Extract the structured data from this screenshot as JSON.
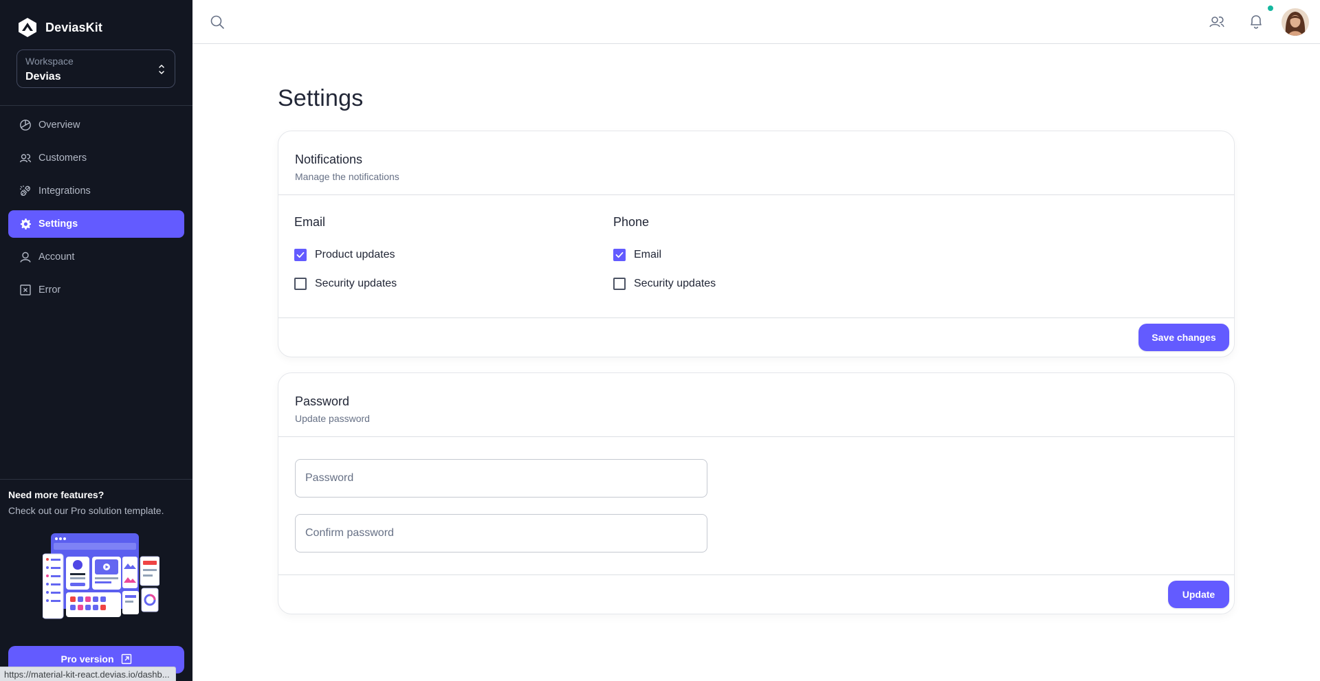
{
  "brand": {
    "name": "DeviasKit"
  },
  "workspace": {
    "label": "Workspace",
    "value": "Devias"
  },
  "nav": [
    {
      "label": "Overview",
      "icon": "chart-pie-icon"
    },
    {
      "label": "Customers",
      "icon": "users-icon"
    },
    {
      "label": "Integrations",
      "icon": "plugs-icon"
    },
    {
      "label": "Settings",
      "icon": "gear-icon",
      "active": true
    },
    {
      "label": "Account",
      "icon": "user-icon"
    },
    {
      "label": "Error",
      "icon": "x-square-icon"
    }
  ],
  "promo": {
    "title": "Need more features?",
    "subtitle": "Check out our Pro solution template.",
    "button": "Pro version"
  },
  "status_url": "https://material-kit-react.devias.io/dashb...",
  "page": {
    "title": "Settings"
  },
  "notifications": {
    "title": "Notifications",
    "subtitle": "Manage the notifications",
    "email": {
      "title": "Email",
      "options": [
        {
          "label": "Product updates",
          "checked": true
        },
        {
          "label": "Security updates",
          "checked": false
        }
      ]
    },
    "phone": {
      "title": "Phone",
      "options": [
        {
          "label": "Email",
          "checked": true
        },
        {
          "label": "Security updates",
          "checked": false
        }
      ]
    },
    "save_label": "Save changes"
  },
  "password": {
    "title": "Password",
    "subtitle": "Update password",
    "password_placeholder": "Password",
    "confirm_placeholder": "Confirm password",
    "update_label": "Update"
  },
  "colors": {
    "primary": "#635bff",
    "sidebar": "#121621",
    "online": "#15b79f"
  }
}
